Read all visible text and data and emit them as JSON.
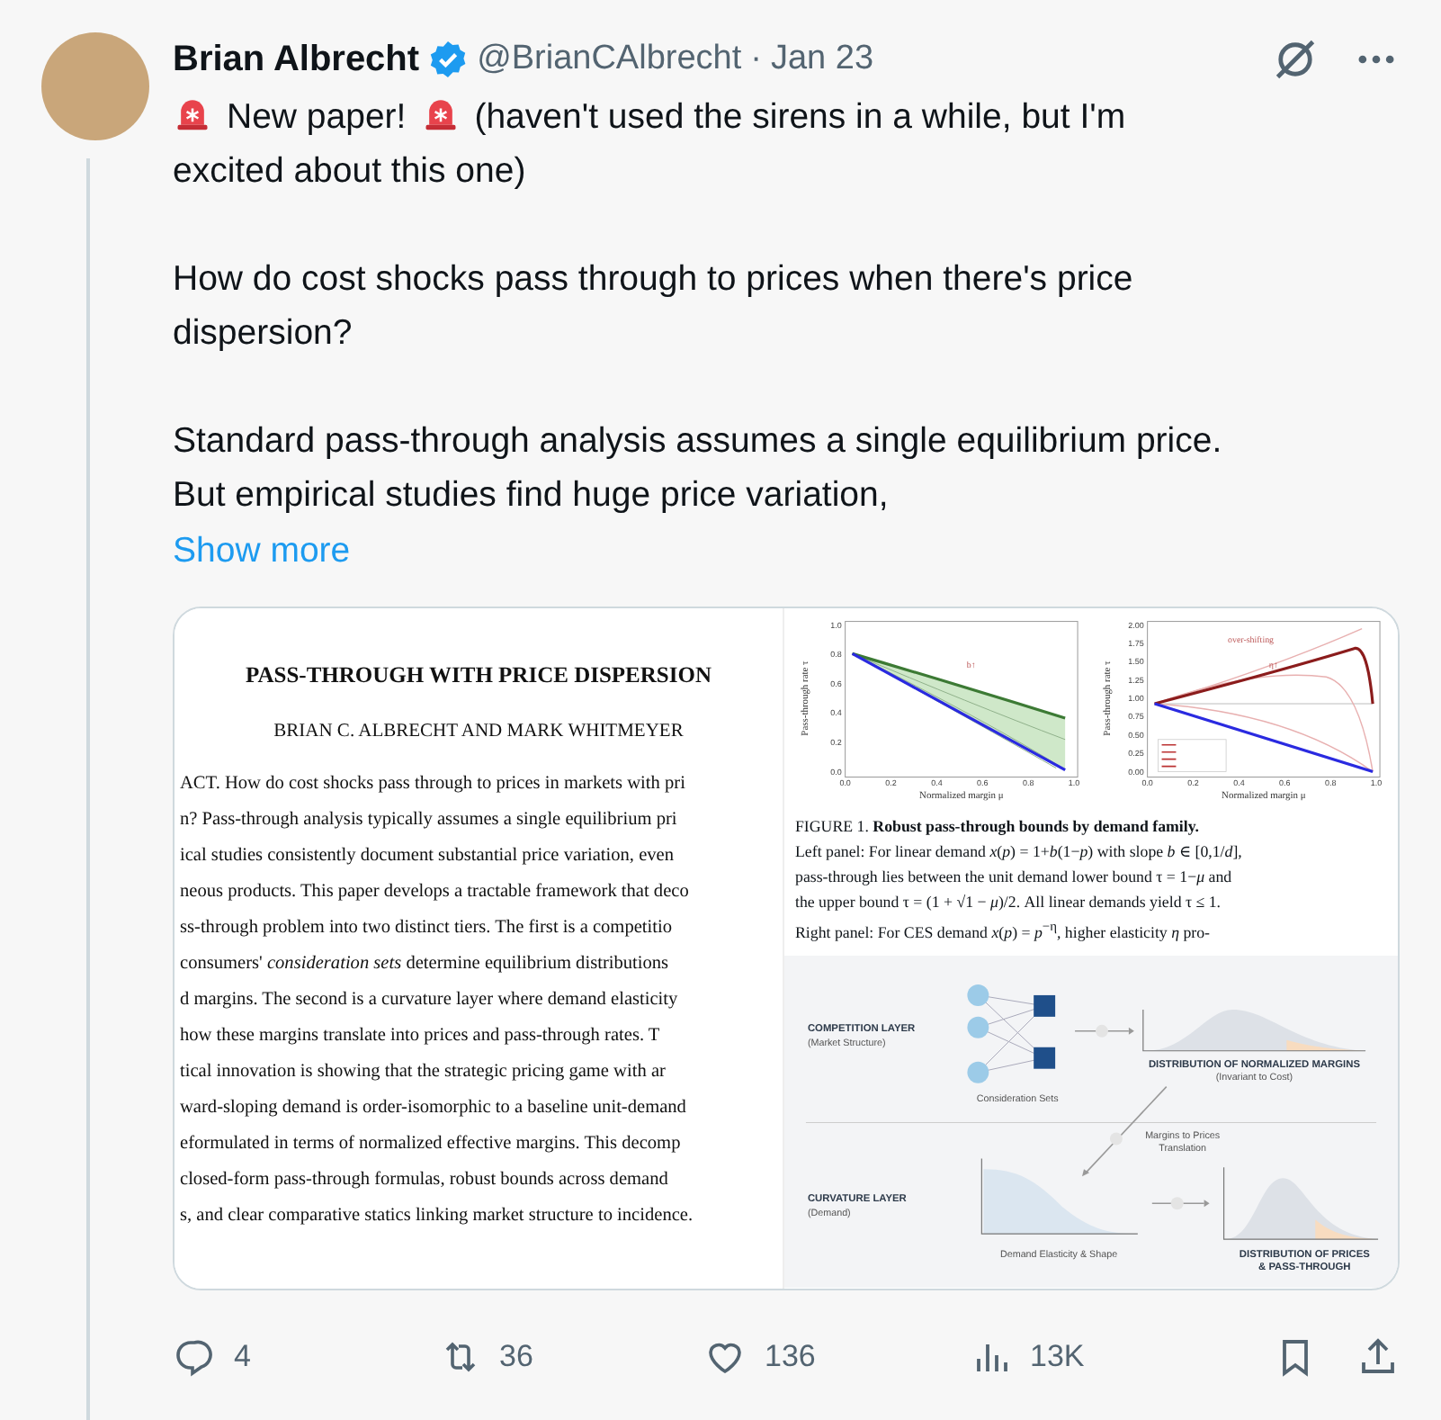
{
  "author": {
    "name": "Brian Albrecht",
    "verified": true,
    "handle": "@BrianCAlbrecht",
    "separator": "·",
    "date": "Jan 23"
  },
  "body": [
    {
      "lines": [
        [
          {
            "kind": "siren"
          },
          {
            "kind": "text",
            "text": "New paper!"
          },
          {
            "kind": "siren"
          },
          {
            "kind": "text",
            "text": "(haven't used the sirens in a while, but I'm"
          }
        ],
        [
          {
            "kind": "text",
            "text": "excited about this one)"
          }
        ]
      ]
    },
    {
      "lines": [
        [
          {
            "kind": "text",
            "text": "How do cost shocks pass through to prices when there's price dispersion?"
          }
        ]
      ]
    },
    {
      "lines": [
        [
          {
            "kind": "text",
            "text": "Standard pass-through analysis assumes a single equilibrium price. But empirical studies find huge price variation,"
          }
        ]
      ]
    }
  ],
  "show_more": "Show more",
  "paper": {
    "title": "PASS-THROUGH WITH PRICE DISPERSION",
    "authors": "BRIAN C. ALBRECHT AND MARK WHITMEYER",
    "lines": [
      "ACT. How do cost shocks pass through to prices in markets with pri",
      "n? Pass-through analysis typically assumes a single equilibrium pri",
      "ical studies consistently document substantial price variation, even",
      "neous products. This paper develops a tractable framework that deco",
      "ss-through problem into two distinct tiers. The first is a competitio",
      "consumers' *consideration sets* determine equilibrium distributions",
      "d margins. The second is a curvature layer where demand elasticity",
      "how these margins translate into prices and pass-through rates. T",
      "tical innovation is showing that the strategic pricing game with ar",
      "ward-sloping demand is order-isomorphic to a baseline unit-demand",
      "eformulated in terms of normalized effective margins. This decomp",
      "closed-form pass-through formulas, robust bounds across demand",
      "s, and clear comparative statics linking market structure to incidence."
    ]
  },
  "figure": {
    "plots": [
      {
        "kind": "linear",
        "xlabel": "Normalized margin μ",
        "ylabel": "Pass-through rate τ",
        "xticks": [
          "0.0",
          "0.2",
          "0.4",
          "0.6",
          "0.8",
          "1.0"
        ],
        "yticks": [
          "1.0",
          "0.8",
          "0.6",
          "0.4",
          "0.2",
          "0.0"
        ],
        "note": "b↑"
      },
      {
        "kind": "ces",
        "xlabel": "Normalized margin μ",
        "ylabel": "Pass-through rate τ",
        "xticks": [
          "0.0",
          "0.2",
          "0.4",
          "0.6",
          "0.8",
          "1.0"
        ],
        "yticks": [
          "2.00",
          "1.75",
          "1.50",
          "1.25",
          "1.00",
          "0.75",
          "0.50",
          "0.25",
          "0.00"
        ],
        "note": "η↑",
        "annotation": "over-shifting"
      }
    ],
    "caption": [
      "FIGURE 1. **Robust pass-through bounds by demand family.**",
      "Left panel: For linear demand *x*(*p*) = 1+*b*(1−*p*) with slope *b* ∈ [0,1/*d*],",
      "pass-through lies between the unit demand lower bound τ = 1−*μ* and",
      "the upper bound τ = (1 + √1 − *μ*)/2. All linear demands yield τ ≤ 1.",
      "Right panel: For CES demand *x*(*p*) = *p*$^{−η}$, higher elasticity *η* pro-"
    ]
  },
  "diagram": {
    "competition_title": "COMPETITION LAYER",
    "competition_sub": "(Market Structure)",
    "sets_label": "Consideration Sets",
    "margins_title": "DISTRIBUTION OF NORMALIZED MARGINS",
    "margins_sub": "(Invariant to Cost)",
    "translation": [
      "Margins to Prices",
      "Translation"
    ],
    "curvature_title": "CURVATURE LAYER",
    "curvature_sub": "(Demand)",
    "elasticity_label": "Demand Elasticity & Shape",
    "prices_title": [
      "DISTRIBUTION OF PRICES",
      "& PASS-THROUGH"
    ]
  },
  "actions": [
    {
      "kind": "reply",
      "count": "4"
    },
    {
      "kind": "repost",
      "count": "36"
    },
    {
      "kind": "like",
      "count": "136"
    },
    {
      "kind": "views",
      "count": "13K"
    },
    {
      "kind": "bookmark"
    },
    {
      "kind": "share"
    }
  ]
}
